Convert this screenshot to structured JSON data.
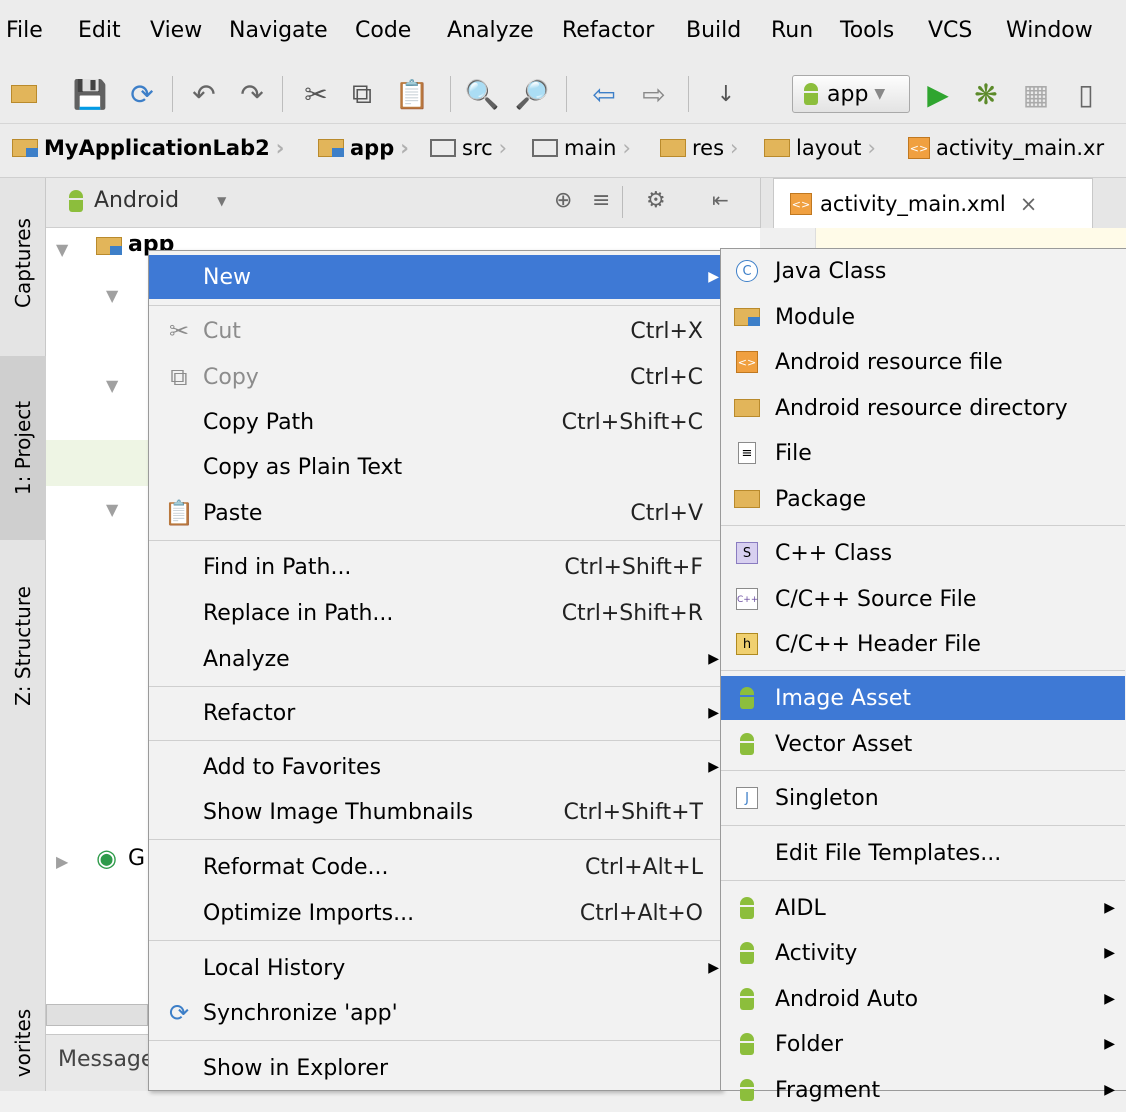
{
  "menubar": [
    "File",
    "Edit",
    "View",
    "Navigate",
    "Code",
    "Analyze",
    "Refactor",
    "Build",
    "Run",
    "Tools",
    "VCS",
    "Window"
  ],
  "toolbar": {
    "run_config": "app"
  },
  "breadcrumb": [
    "MyApplicationLab2",
    "app",
    "src",
    "main",
    "res",
    "layout",
    "activity_main.xr"
  ],
  "toolwindows": {
    "captures": "Captures",
    "project": "1: Project",
    "structure": "Z: Structure",
    "favorites": "vorites"
  },
  "project_panel": {
    "view_mode": "Android",
    "tree_root": "app",
    "tree_item_g": "G",
    "messages_tab": "Message"
  },
  "editor": {
    "tab": "activity_main.xml",
    "tab_close": "×"
  },
  "context_menu": [
    {
      "label": "New",
      "shortcut": "",
      "submenu": true,
      "selected": true
    },
    {
      "label": "Cut",
      "shortcut": "Ctrl+X",
      "disabled": true
    },
    {
      "label": "Copy",
      "shortcut": "Ctrl+C",
      "disabled": true
    },
    {
      "label": "Copy Path",
      "shortcut": "Ctrl+Shift+C"
    },
    {
      "label": "Copy as Plain Text",
      "shortcut": ""
    },
    {
      "label": "Paste",
      "shortcut": "Ctrl+V"
    },
    {
      "label": "Find in Path...",
      "shortcut": "Ctrl+Shift+F"
    },
    {
      "label": "Replace in Path...",
      "shortcut": "Ctrl+Shift+R"
    },
    {
      "label": "Analyze",
      "shortcut": "",
      "submenu": true
    },
    {
      "label": "Refactor",
      "shortcut": "",
      "submenu": true
    },
    {
      "label": "Add to Favorites",
      "shortcut": "",
      "submenu": true
    },
    {
      "label": "Show Image Thumbnails",
      "shortcut": "Ctrl+Shift+T"
    },
    {
      "label": "Reformat Code...",
      "shortcut": "Ctrl+Alt+L"
    },
    {
      "label": "Optimize Imports...",
      "shortcut": "Ctrl+Alt+O"
    },
    {
      "label": "Local History",
      "shortcut": "",
      "submenu": true
    },
    {
      "label": "Synchronize 'app'",
      "shortcut": ""
    },
    {
      "label": "Show in Explorer",
      "shortcut": ""
    }
  ],
  "new_submenu": [
    {
      "label": "Java Class"
    },
    {
      "label": "Module"
    },
    {
      "label": "Android resource file"
    },
    {
      "label": "Android resource directory"
    },
    {
      "label": "File"
    },
    {
      "label": "Package"
    },
    {
      "label": "C++ Class"
    },
    {
      "label": "C/C++ Source File"
    },
    {
      "label": "C/C++ Header File"
    },
    {
      "label": "Image Asset",
      "selected": true
    },
    {
      "label": "Vector Asset"
    },
    {
      "label": "Singleton"
    },
    {
      "label": "Edit File Templates..."
    },
    {
      "label": "AIDL",
      "submenu": true
    },
    {
      "label": "Activity",
      "submenu": true
    },
    {
      "label": "Android Auto",
      "submenu": true
    },
    {
      "label": "Folder",
      "submenu": true
    },
    {
      "label": "Fragment",
      "submenu": true
    }
  ],
  "icons": {
    "java_class_letter": "C",
    "cpp_class_letter": "S",
    "cpp_source_letter": "C++",
    "header_letter": "h",
    "singleton_letter": "J"
  },
  "colors": {
    "selection": "#3e79d5",
    "android_green": "#8cbe3c",
    "folder": "#e2b55a"
  }
}
